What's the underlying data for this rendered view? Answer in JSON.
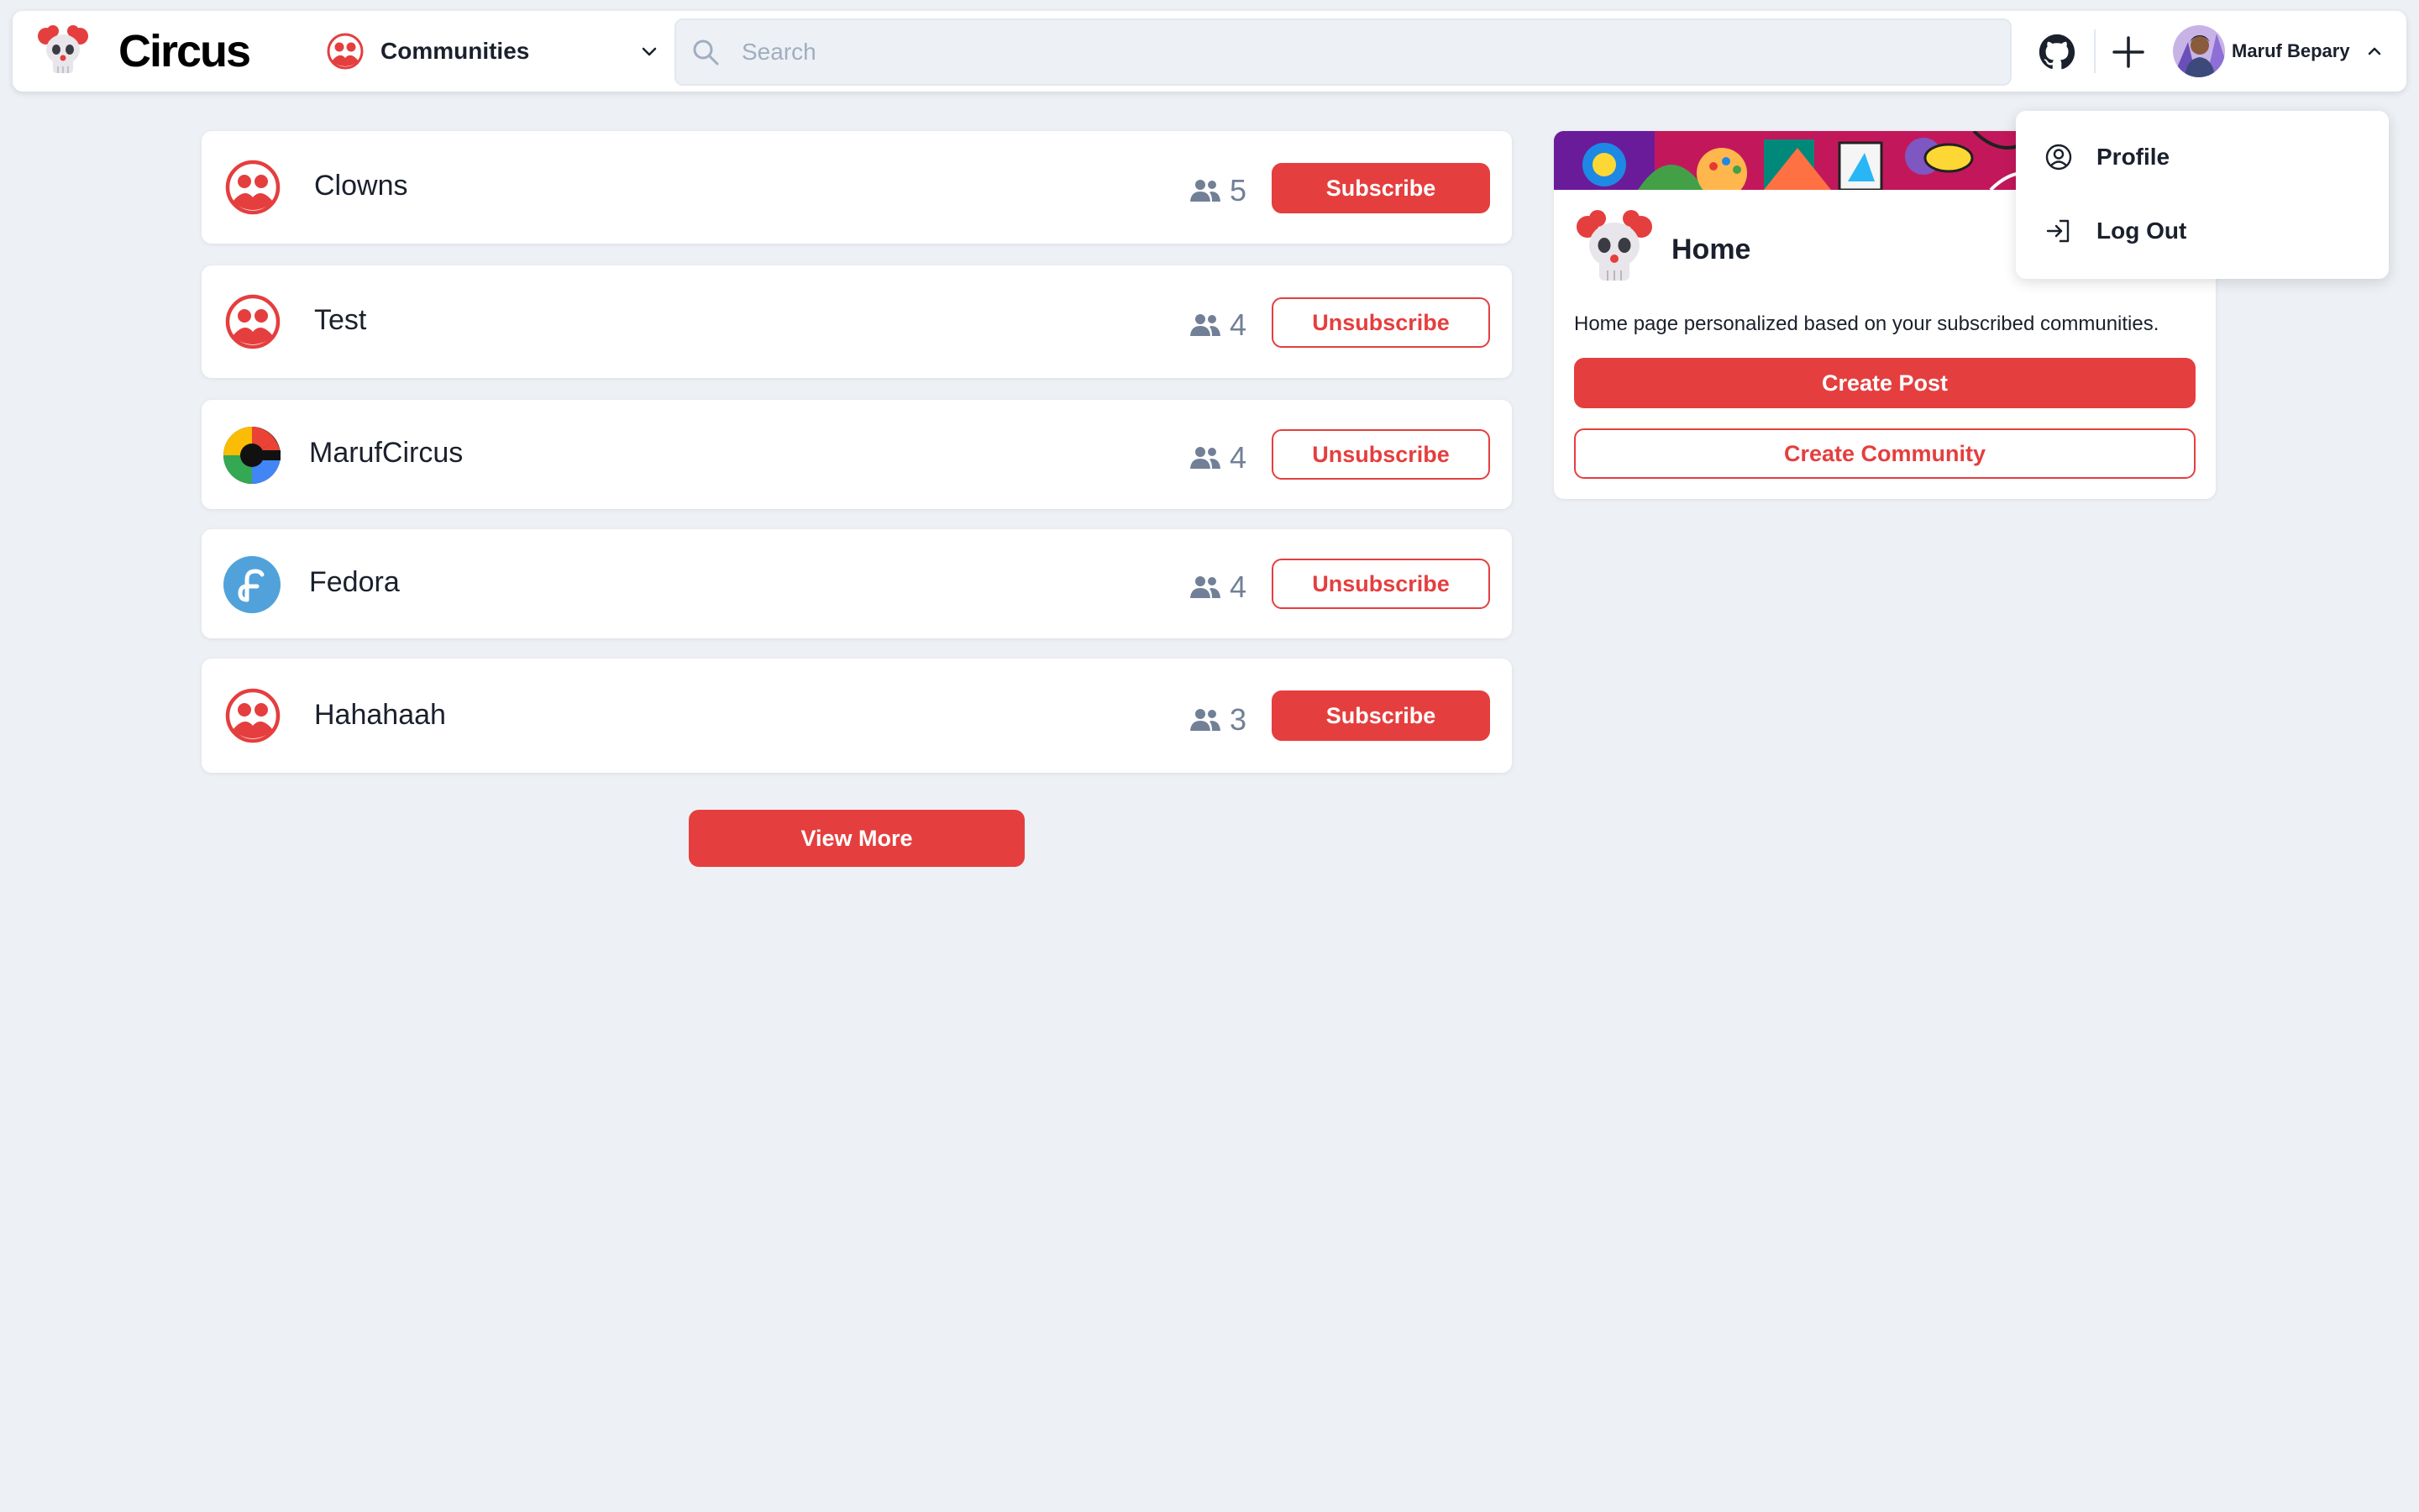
{
  "header": {
    "logo_text": "Circus",
    "community_select": {
      "label": "Communities"
    },
    "search": {
      "placeholder": "Search",
      "value": ""
    },
    "user": {
      "name": "Maruf Bepary"
    }
  },
  "user_dropdown": {
    "items": [
      {
        "label": "Profile",
        "icon": "user-circle-icon"
      },
      {
        "label": "Log Out",
        "icon": "logout-icon"
      }
    ]
  },
  "communities": [
    {
      "name": "Clowns",
      "members": "5",
      "action": "Subscribe",
      "icon": "community-icon"
    },
    {
      "name": "Test",
      "members": "4",
      "action": "Unsubscribe",
      "icon": "community-icon"
    },
    {
      "name": "MarufCircus",
      "members": "4",
      "action": "Unsubscribe",
      "icon": "google-logo-icon"
    },
    {
      "name": "Fedora",
      "members": "4",
      "action": "Unsubscribe",
      "icon": "fedora-logo-icon"
    },
    {
      "name": "Hahahaah",
      "members": "3",
      "action": "Subscribe",
      "icon": "community-icon"
    }
  ],
  "view_more_label": "View More",
  "home_card": {
    "title": "Home",
    "description": "Home page personalized based on your subscribed communities.",
    "create_post_label": "Create Post",
    "create_community_label": "Create Community"
  },
  "colors": {
    "accent": "#e53e3e",
    "background": "#edf1f5",
    "muted_text": "#718096"
  }
}
